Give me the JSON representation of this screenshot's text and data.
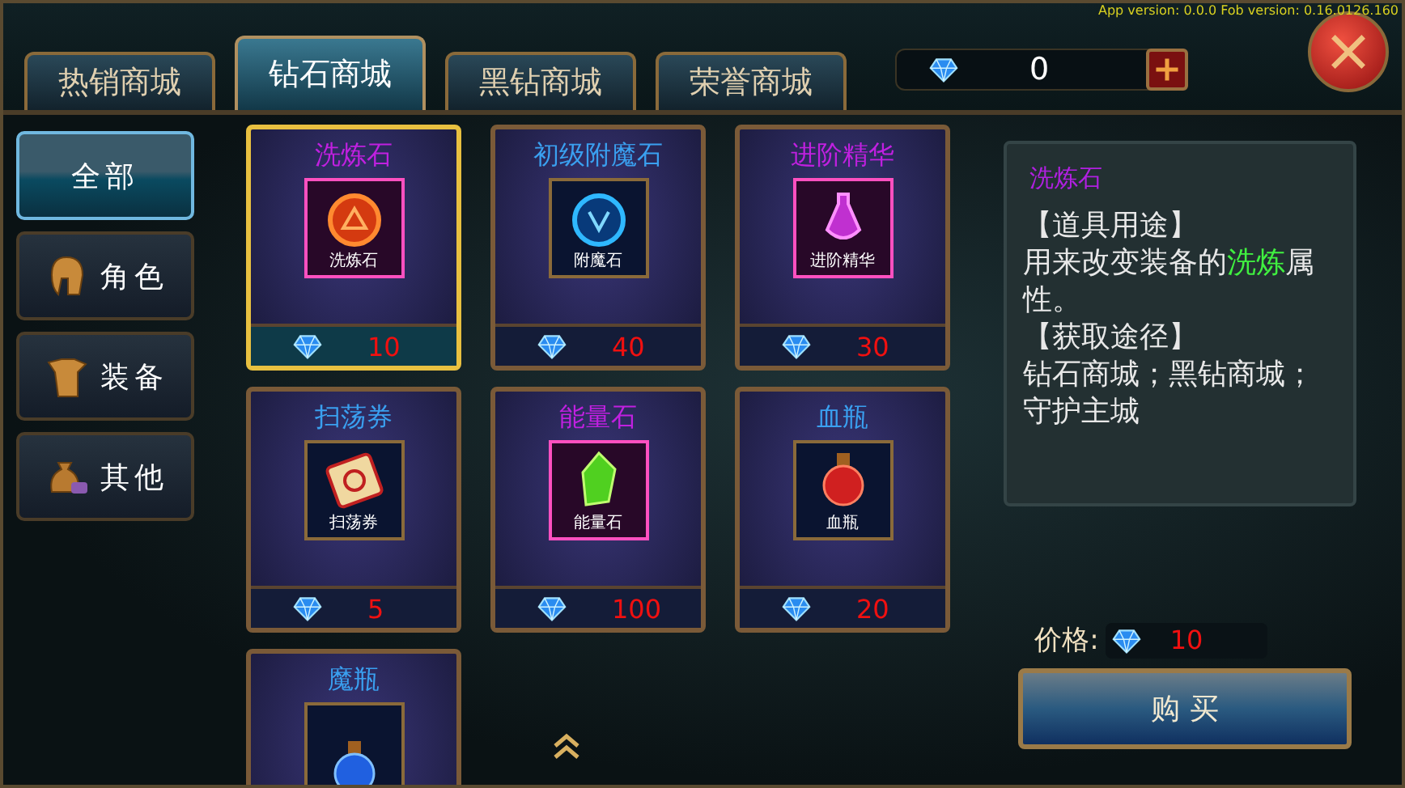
{
  "debug_overlay": {
    "version_text": "App version: 0.0.0 Fob version: 0.16.0126.160"
  },
  "tabs": [
    {
      "label": "热销商城",
      "selected": false
    },
    {
      "label": "钻石商城",
      "selected": true
    },
    {
      "label": "黑钻商城",
      "selected": false
    },
    {
      "label": "荣誉商城",
      "selected": false
    }
  ],
  "currency": {
    "amount": "0"
  },
  "sidebar": {
    "items": [
      {
        "label": "全部",
        "selected": true
      },
      {
        "label": "角色",
        "selected": false
      },
      {
        "label": "装备",
        "selected": false
      },
      {
        "label": "其他",
        "selected": false
      }
    ]
  },
  "items": [
    {
      "name": "洗炼石",
      "icon_label": "洗炼石",
      "price": "10",
      "kind": "epic",
      "selected": true
    },
    {
      "name": "初级附魔石",
      "icon_label": "附魔石",
      "price": "40",
      "kind": "rare",
      "selected": false
    },
    {
      "name": "进阶精华",
      "icon_label": "进阶精华",
      "price": "30",
      "kind": "epic",
      "selected": false
    },
    {
      "name": "扫荡券",
      "icon_label": "扫荡券",
      "price": "5",
      "kind": "rare",
      "selected": false
    },
    {
      "name": "能量石",
      "icon_label": "能量石",
      "price": "100",
      "kind": "epic",
      "selected": false
    },
    {
      "name": "血瓶",
      "icon_label": "血瓶",
      "price": "20",
      "kind": "rare",
      "selected": false
    },
    {
      "name": "魔瓶",
      "kind": "rare",
      "selected": false
    }
  ],
  "detail": {
    "title": "洗炼石",
    "sections": [
      {
        "heading": "【道具用途】",
        "body": [
          {
            "text": "用来改变装备的",
            "highlight": false
          },
          {
            "text": "洗炼",
            "highlight": true
          },
          {
            "text": "属性。",
            "highlight": false
          }
        ]
      },
      {
        "heading": "【获取途径】",
        "body": [
          {
            "text": "钻石商城；黑钻商城；守护主城",
            "highlight": false
          }
        ]
      }
    ]
  },
  "price": {
    "label": "价格:",
    "value": "10"
  },
  "buy_button": {
    "label": "购 买"
  }
}
